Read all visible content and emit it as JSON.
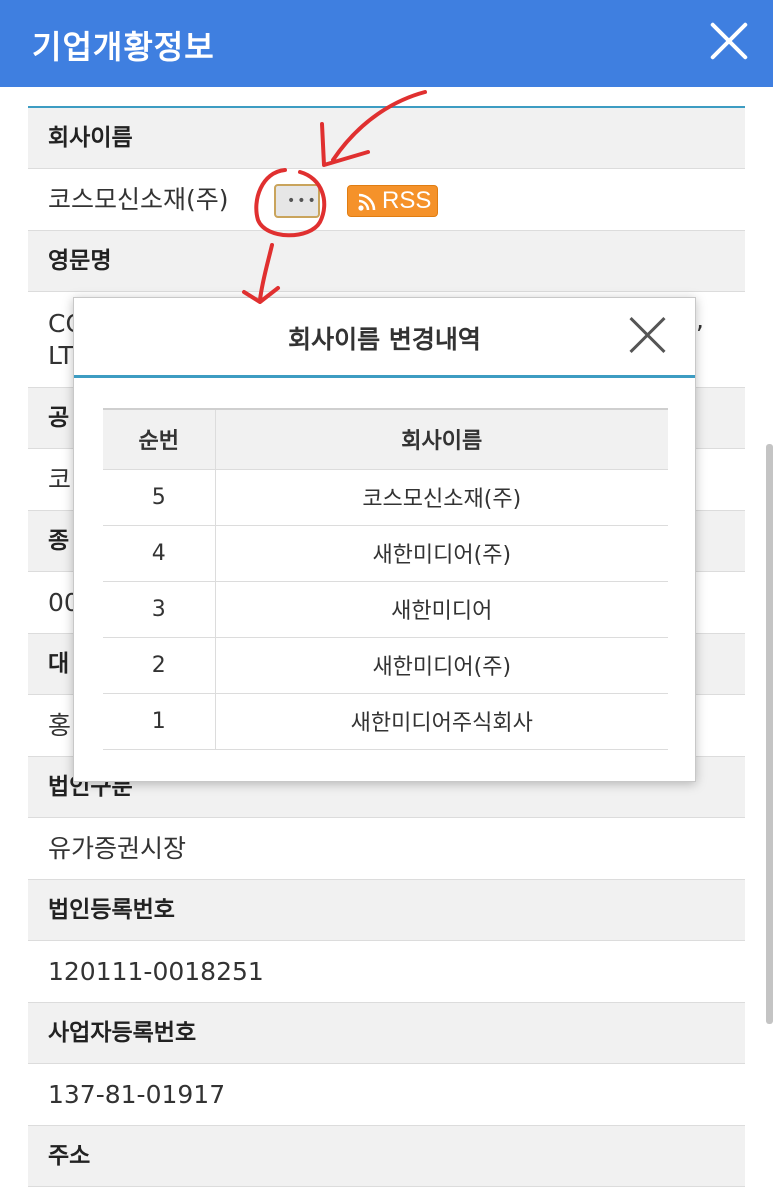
{
  "header": {
    "title": "기업개황정보"
  },
  "company": {
    "name_label": "회사이름",
    "name_value": "코스모신소재(주)",
    "more_label": "•••",
    "rss_label": "RSS",
    "eng_label": "영문명",
    "eng_value_line1": "CC",
    "eng_value_line2": "LT",
    "eng_value_tail": ",",
    "row3_label": "공",
    "row3_value": "코",
    "row4_label": "종",
    "row4_value": "00",
    "row5_label": "대",
    "row5_value": "홍",
    "corp_type_label": "법인구분",
    "corp_type_value": "유가증권시장",
    "corp_reg_label": "법인등록번호",
    "corp_reg_value": "120111-0018251",
    "biz_reg_label": "사업자등록번호",
    "biz_reg_value": "137-81-01917",
    "address_label": "주소"
  },
  "modal": {
    "title": "회사이름 변경내역",
    "col_no": "순번",
    "col_name": "회사이름",
    "rows": [
      {
        "no": "5",
        "name": "코스모신소재(주)"
      },
      {
        "no": "4",
        "name": "새한미디어(주)"
      },
      {
        "no": "3",
        "name": "새한미디어"
      },
      {
        "no": "2",
        "name": "새한미디어(주)"
      },
      {
        "no": "1",
        "name": "새한미디어주식회사"
      }
    ]
  },
  "colors": {
    "header": "#3f7fe0",
    "accent_line": "#3d9cc2",
    "rss": "#f5922a",
    "annotation": "#e03030"
  },
  "icons": {
    "header_close": "close-icon",
    "modal_close": "close-icon",
    "rss": "rss-icon"
  }
}
